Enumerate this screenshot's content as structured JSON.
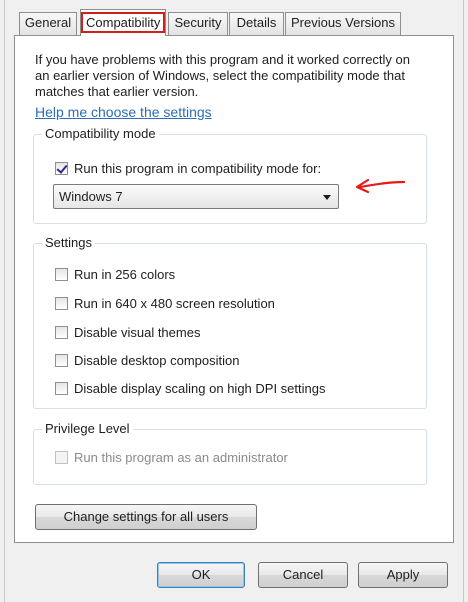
{
  "tabs": [
    {
      "label": "General"
    },
    {
      "label": "Compatibility"
    },
    {
      "label": "Security"
    },
    {
      "label": "Details"
    },
    {
      "label": "Previous Versions"
    }
  ],
  "intro_text": "If you have problems with this program and it worked correctly on an earlier version of Windows, select the compatibility mode that matches that earlier version.",
  "help_link": "Help me choose the settings",
  "compatibility_mode": {
    "title": "Compatibility mode",
    "checkbox_label": "Run this program in compatibility mode for:",
    "checked": true,
    "selected_os": "Windows 7"
  },
  "settings": {
    "title": "Settings",
    "items": [
      {
        "label": "Run in 256 colors",
        "checked": false
      },
      {
        "label": "Run in 640 x 480 screen resolution",
        "checked": false
      },
      {
        "label": "Disable visual themes",
        "checked": false
      },
      {
        "label": "Disable desktop composition",
        "checked": false
      },
      {
        "label": "Disable display scaling on high DPI settings",
        "checked": false
      }
    ]
  },
  "privilege": {
    "title": "Privilege Level",
    "checkbox_label": "Run this program as an administrator",
    "checked": false,
    "disabled": true
  },
  "change_all_users_label": "Change settings for all users",
  "buttons": {
    "ok": "OK",
    "cancel": "Cancel",
    "apply": "Apply"
  },
  "colors": {
    "annotation_arrow": "#e8191b",
    "tab_highlight": "#cf1f1f",
    "link": "#2c6fb7"
  }
}
